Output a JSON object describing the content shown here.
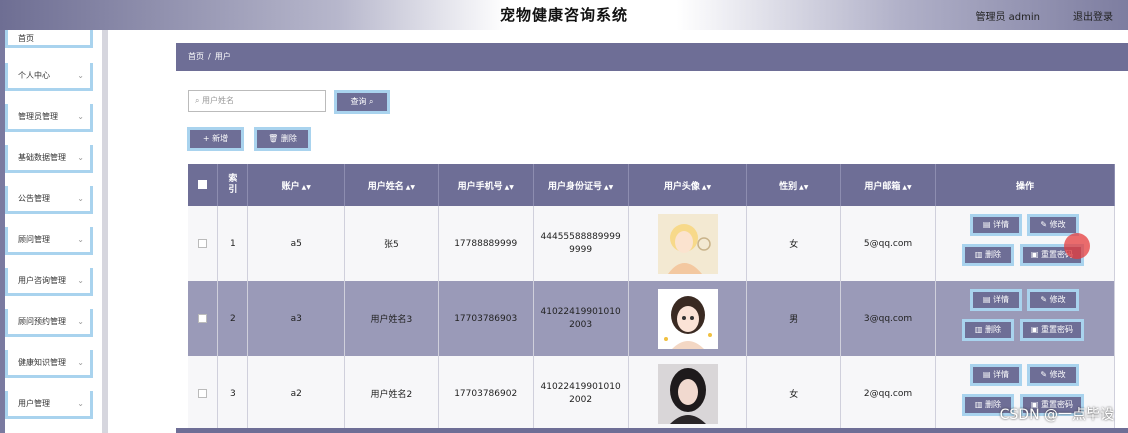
{
  "header": {
    "title": "宠物健康咨询系统",
    "admin": "管理员 admin",
    "logout": "退出登录"
  },
  "sidebar": {
    "items": [
      {
        "label": "首页"
      },
      {
        "label": "个人中心"
      },
      {
        "label": "管理员管理"
      },
      {
        "label": "基础数据管理"
      },
      {
        "label": "公告管理"
      },
      {
        "label": "顾问管理"
      },
      {
        "label": "用户咨询管理"
      },
      {
        "label": "顾问预约管理"
      },
      {
        "label": "健康知识管理"
      },
      {
        "label": "用户管理"
      }
    ]
  },
  "breadcrumb": {
    "home": "首页",
    "sep": "/",
    "current": "用户"
  },
  "toolbar": {
    "search_placeholder": "用户姓名",
    "query": "查询",
    "add": "新增",
    "delete": "删除"
  },
  "table": {
    "headers": [
      "",
      "索引",
      "账户",
      "用户姓名",
      "用户手机号",
      "用户身份证号",
      "用户头像",
      "性别",
      "用户邮箱",
      "操作"
    ],
    "rows": [
      {
        "index": "1",
        "account": "a5",
        "name": "张5",
        "phone": "17788889999",
        "idcard": "444555888899999999",
        "gender": "女",
        "email": "5@qq.com"
      },
      {
        "index": "2",
        "account": "a3",
        "name": "用户姓名3",
        "phone": "17703786903",
        "idcard": "410224199010102003",
        "gender": "男",
        "email": "3@qq.com"
      },
      {
        "index": "3",
        "account": "a2",
        "name": "用户姓名2",
        "phone": "17703786902",
        "idcard": "410224199010102002",
        "gender": "女",
        "email": "2@qq.com"
      }
    ],
    "ops": {
      "detail": "详情",
      "edit": "修改",
      "delete": "删除",
      "reset": "重置密码"
    }
  },
  "watermark": "CSDN @一点毕设",
  "colors": {
    "primary": "#6e6e96",
    "accent_border": "#a9d3ee",
    "alt_row": "#9a9ab8"
  }
}
